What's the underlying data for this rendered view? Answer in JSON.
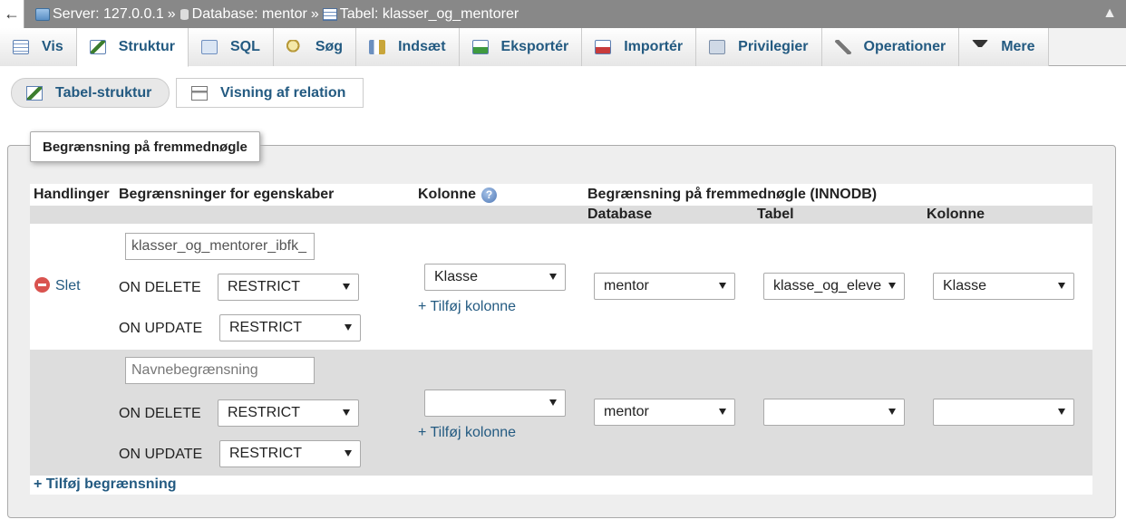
{
  "breadcrumb": {
    "server": "Server: 127.0.0.1",
    "database": "Database: mentor",
    "table": "Tabel: klasser_og_mentorer",
    "separator": "»"
  },
  "tabs": [
    {
      "label": "Vis",
      "icon": "browse-icon"
    },
    {
      "label": "Struktur",
      "icon": "structure-icon"
    },
    {
      "label": "SQL",
      "icon": "sql-icon"
    },
    {
      "label": "Søg",
      "icon": "search-icon"
    },
    {
      "label": "Indsæt",
      "icon": "insert-icon"
    },
    {
      "label": "Eksportér",
      "icon": "export-icon"
    },
    {
      "label": "Importér",
      "icon": "import-icon"
    },
    {
      "label": "Privilegier",
      "icon": "privileges-icon"
    },
    {
      "label": "Operationer",
      "icon": "wrench-icon"
    },
    {
      "label": "Mere",
      "icon": "caret-down-icon"
    }
  ],
  "subtabs": {
    "structure": "Tabel-struktur",
    "relation": "Visning af relation"
  },
  "fieldset": {
    "legend": "Begrænsning på fremmednøgle"
  },
  "table": {
    "headers": {
      "actions": "Handlinger",
      "constraint_props": "Begrænsninger for egenskaber",
      "column": "Kolonne",
      "fk_constraint": "Begrænsning på fremmednøgle (INNODB)",
      "database": "Database",
      "table": "Tabel",
      "fk_column": "Kolonne"
    },
    "rows": [
      {
        "delete_label": "Slet",
        "name_value": "klasser_og_mentorer_ibfk_",
        "on_delete_label": "ON DELETE",
        "on_delete_value": "RESTRICT",
        "on_update_label": "ON UPDATE",
        "on_update_value": "RESTRICT",
        "column_value": "Klasse",
        "add_column": "+ Tilføj kolonne",
        "db_value": "mentor",
        "table_value": "klasse_og_eleve",
        "fk_column_value": "Klasse"
      },
      {
        "name_placeholder": "Navnebegrænsning",
        "on_delete_label": "ON DELETE",
        "on_delete_value": "RESTRICT",
        "on_update_label": "ON UPDATE",
        "on_update_value": "RESTRICT",
        "column_value": "",
        "add_column": "+ Tilføj kolonne",
        "db_value": "mentor",
        "table_value": "",
        "fk_column_value": ""
      }
    ],
    "add_constraint": "+ Tilføj begrænsning"
  }
}
